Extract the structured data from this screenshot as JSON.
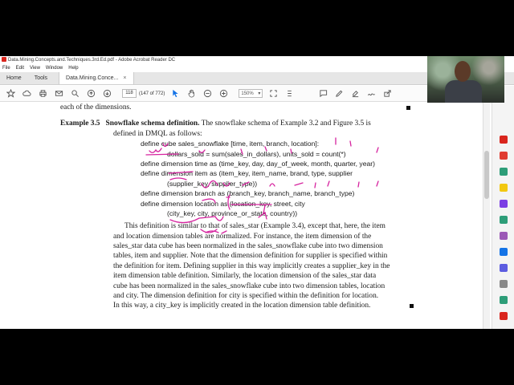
{
  "window": {
    "title": "Data.Mining.Concepts.and.Techniques.3rd.Ed.pdf - Adobe Acrobat Reader DC"
  },
  "menu": [
    "File",
    "Edit",
    "View",
    "Window",
    "Help"
  ],
  "tabs": {
    "home": "Home",
    "tools": "Tools",
    "document": "Data.Mining.Conce...",
    "close": "×"
  },
  "toolbar": {
    "page_current": "118",
    "page_total": "(147 of 772)",
    "zoom": "150%",
    "zoom_caret": "▾"
  },
  "document": {
    "prev_line": "each of the dimensions.",
    "example_label": "Example 3.5",
    "example_title": "Snowflake schema definition.",
    "example_intro_1": "The snowflake schema of Example 3.2 and Figure 3.5 is",
    "example_intro_2": "defined in DMQL as follows:",
    "code": [
      "define cube sales_snowflake [time, item, branch, location]:",
      "dollars_sold = sum(sales_in_dollars), units_sold = count(*)",
      "define dimension time as (time_key, day, day_of_week, month, quarter, year)",
      "define dimension item as (item_key, item_name, brand, type, supplier",
      "(supplier_key, supplier_type))",
      "define dimension branch as (branch_key, branch_name, branch_type)",
      "define dimension location as (location_key, street, city",
      "(city_key, city, province_or_state, country))"
    ],
    "paragraph": [
      "This definition is similar to that of sales_star (Example 3.4), except that, here, the item",
      "and location dimension tables are normalized. For instance, the item dimension of the",
      "sales_star data cube has been normalized in the sales_snowflake cube into two dimension",
      "tables, item and supplier. Note that the dimension definition for supplier is specified within",
      "the definition for item. Defining supplier in this way implicitly creates a supplier_key in the",
      "item dimension table definition. Similarly, the location dimension of the sales_star data",
      "cube has been normalized in the sales_snowflake cube into two dimension tables, location",
      "and city. The dimension definition for city is specified within the definition for location.",
      "In this way, a city_key is implicitly created in the location dimension table definition."
    ]
  },
  "colors": {
    "annotation": "#d6249f",
    "accent": "#1473e6",
    "app_red": "#d9251d"
  },
  "icons": [
    "star-icon",
    "upload-icon",
    "print-icon",
    "mail-icon",
    "search-icon",
    "prev-page-icon",
    "next-page-icon",
    "cursor-icon",
    "hand-icon",
    "zoom-out-icon",
    "zoom-in-icon",
    "fit-icon",
    "scroll-icon",
    "comment-icon",
    "pen-icon",
    "highlight-icon",
    "sign-icon",
    "share-icon"
  ]
}
